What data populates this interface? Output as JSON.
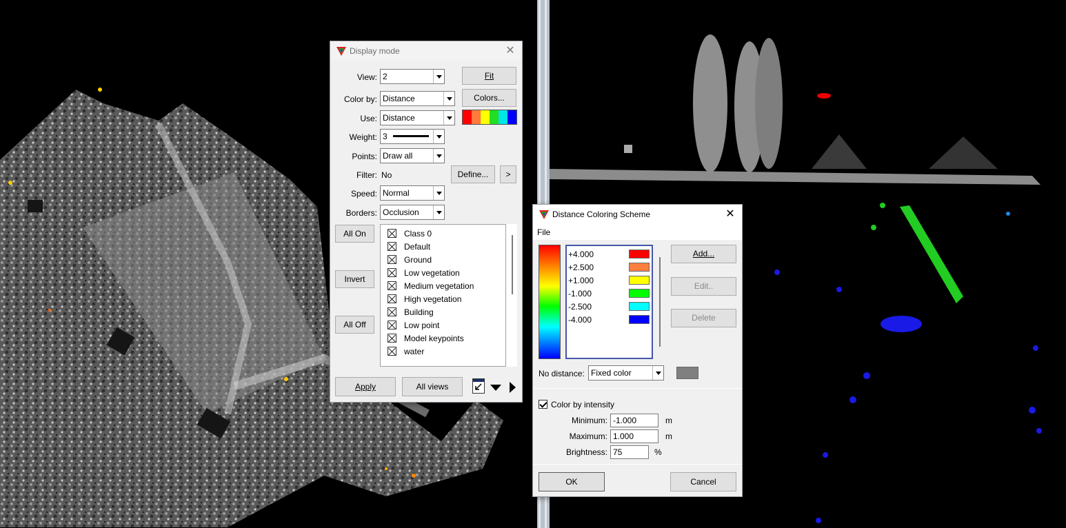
{
  "display_mode": {
    "title": "Display mode",
    "view_label": "View:",
    "view_value": "2",
    "fit_label": "Fit",
    "color_by_label": "Color by:",
    "color_by_value": "Distance",
    "colors_label": "Colors...",
    "use_label": "Use:",
    "use_value": "Distance",
    "weight_label": "Weight:",
    "weight_value": "3",
    "points_label": "Points:",
    "points_value": "Draw all",
    "filter_label": "Filter:",
    "filter_value": "No",
    "define_label": "Define...",
    "more_label": ">",
    "speed_label": "Speed:",
    "speed_value": "Normal",
    "borders_label": "Borders:",
    "borders_value": "Occlusion",
    "all_on_label": "All On",
    "invert_label": "Invert",
    "all_off_label": "All Off",
    "classes": [
      "Class 0",
      "Default",
      "Ground",
      "Low vegetation",
      "Medium vegetation",
      "High vegetation",
      "Building",
      "Low point",
      "Model keypoints",
      "water"
    ],
    "apply_label": "Apply",
    "all_views_label": "All views",
    "swatch_colors": [
      "#ff0000",
      "#ff7a3c",
      "#ffff00",
      "#22dd22",
      "#00e5e5",
      "#0000ff"
    ]
  },
  "coloring": {
    "title": "Distance Coloring Scheme",
    "menu_file": "File",
    "levels": [
      {
        "value": "+4.000",
        "color": "#ff0000"
      },
      {
        "value": "+2.500",
        "color": "#ff7f40"
      },
      {
        "value": "+1.000",
        "color": "#ffff00"
      },
      {
        "value": "-1.000",
        "color": "#00ff00"
      },
      {
        "value": "-2.500",
        "color": "#00ffff"
      },
      {
        "value": "-4.000",
        "color": "#0000ff"
      }
    ],
    "add_label": "Add...",
    "edit_label": "Edit..",
    "delete_label": "Delete",
    "no_distance_label": "No distance:",
    "no_distance_value": "Fixed color",
    "no_distance_color": "#808080",
    "intensity_label": "Color by intensity",
    "minimum_label": "Minimum:",
    "minimum_value": "-1.000",
    "maximum_label": "Maximum:",
    "maximum_value": "1.000",
    "brightness_label": "Brightness:",
    "brightness_value": "75",
    "unit_m": "m",
    "unit_pct": "%",
    "ok_label": "OK",
    "cancel_label": "Cancel"
  }
}
